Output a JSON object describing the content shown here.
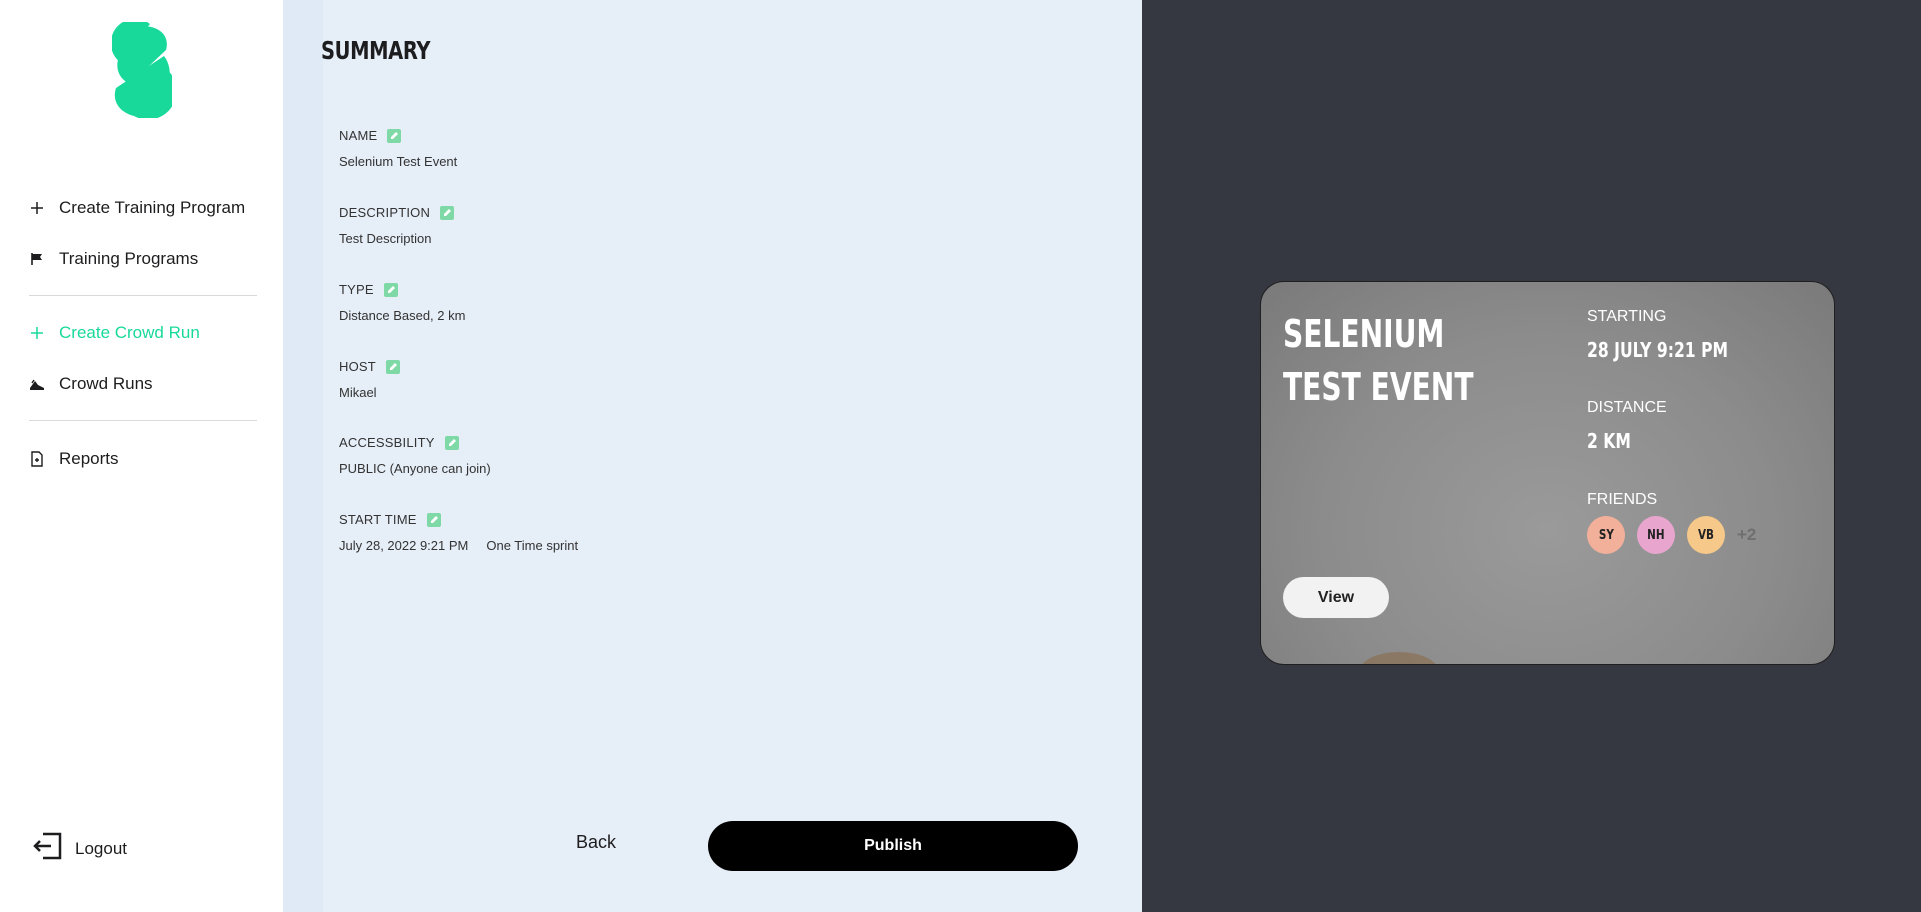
{
  "sidebar": {
    "items": [
      {
        "label": "Create Training Program",
        "icon": "plus-icon"
      },
      {
        "label": "Training Programs",
        "icon": "flag-icon"
      },
      {
        "label": "Create Crowd Run",
        "icon": "plus-icon",
        "active": true
      },
      {
        "label": "Crowd Runs",
        "icon": "running-shoe-icon"
      },
      {
        "label": "Reports",
        "icon": "report-icon"
      }
    ],
    "logout_label": "Logout"
  },
  "summary": {
    "title": "SUMMARY",
    "fields": [
      {
        "label": "NAME",
        "value": "Selenium Test Event"
      },
      {
        "label": "DESCRIPTION",
        "value": "Test Description"
      },
      {
        "label": "TYPE",
        "value": "Distance Based, 2 km"
      },
      {
        "label": "HOST",
        "value": "Mikael"
      },
      {
        "label": "ACCESSBILITY",
        "value": "PUBLIC (Anyone can join)"
      },
      {
        "label": "START TIME",
        "value": "July 28, 2022 9:21 PM",
        "value2": "One Time sprint"
      }
    ],
    "back_label": "Back",
    "publish_label": "Publish"
  },
  "preview": {
    "title": "SELENIUM TEST EVENT",
    "starting_label": "STARTING",
    "starting_value": "28 JULY 9:21 PM",
    "distance_label": "DISTANCE",
    "distance_value": "2 KM",
    "friends_label": "FRIENDS",
    "friends": [
      {
        "initials": "SY",
        "color": "#f2b09a"
      },
      {
        "initials": "NH",
        "color": "#e8a6cf"
      },
      {
        "initials": "VB",
        "color": "#f6c98a"
      }
    ],
    "more_friends": "+2",
    "view_label": "View"
  },
  "colors": {
    "accent": "#19d99a",
    "middle_bg": "#e6eef8",
    "right_bg": "#353840"
  }
}
